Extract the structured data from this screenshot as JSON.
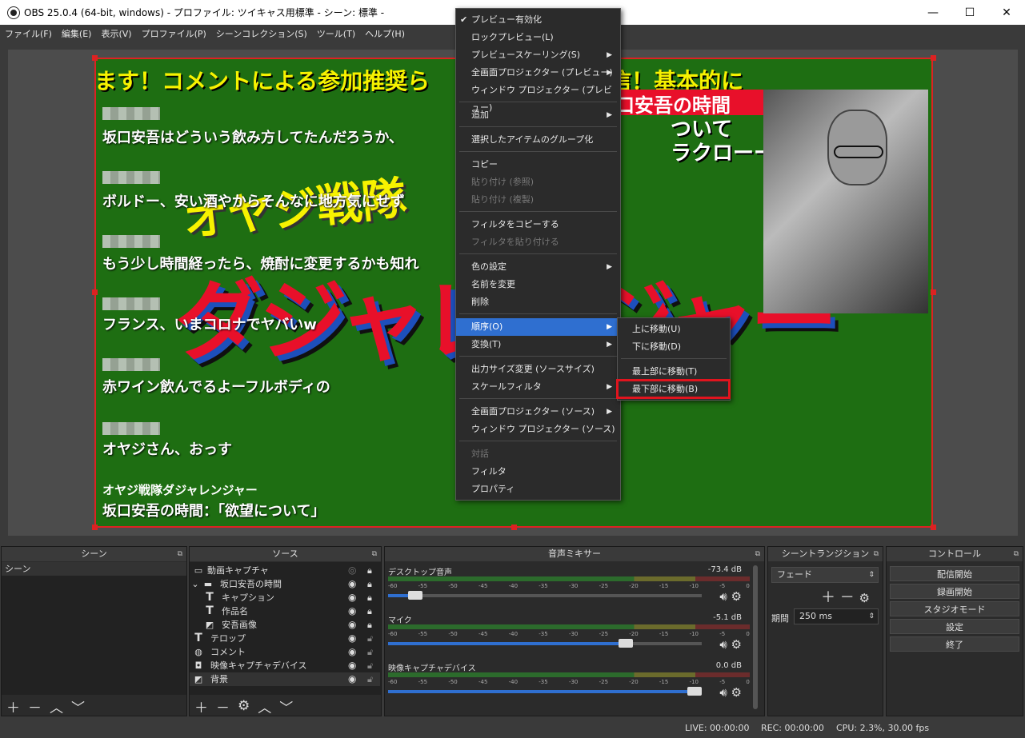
{
  "window": {
    "title": "OBS 25.0.4 (64-bit, windows) - プロファイル: ツイキャス用標準 - シーン: 標準 -",
    "minimize": "—",
    "maximize": "☐",
    "close": "✕"
  },
  "menu": [
    "ファイル(F)",
    "編集(E)",
    "表示(V)",
    "プロファイル(P)",
    "シーンコレクション(S)",
    "ツール(T)",
    "ヘルプ(H)"
  ],
  "preview": {
    "ticker": "ます！コメントによる参加推奨ら　　期気まぐれ配信！基本的に",
    "comments": [
      "坂口安吾はどういう飲み方してたんだろうか、",
      "ボルドー、安い酒やからそんなに地方気にせず",
      "もう少し時間経ったら、焼酎に変更するかも知れ",
      "フランス、いまコロナでヤバいw",
      "赤ワイン飲んでるよーフルボディの",
      "オヤジさん、おっす"
    ],
    "program_name": "オヤジ戦隊ダジャレンジャー",
    "program_topic": "坂口安吾の時間：「欲望について」",
    "subtitle": "オヤジ戦隊",
    "big_title": "ダジャレンジャー",
    "red_box": "口安吾の時間",
    "white_big_1": "ついて",
    "white_big_2": "ラクローー」"
  },
  "context_menu": {
    "items": [
      {
        "label": "プレビュー有効化",
        "checked": true
      },
      {
        "label": "ロックプレビュー(L)"
      },
      {
        "label": "プレビュースケーリング(S)",
        "submenu": true
      },
      {
        "label": "全画面プロジェクター (プレビュー)",
        "submenu": true
      },
      {
        "label": "ウィンドウ プロジェクター (プレビュー)"
      },
      {
        "label": "追加",
        "submenu": true
      },
      {
        "label": "選択したアイテムのグループ化"
      },
      {
        "label": "コピー"
      },
      {
        "label": "貼り付け (参照)",
        "disabled": true
      },
      {
        "label": "貼り付け (複製)",
        "disabled": true
      },
      {
        "label": "フィルタをコピーする"
      },
      {
        "label": "フィルタを貼り付ける",
        "disabled": true
      },
      {
        "label": "色の設定",
        "submenu": true
      },
      {
        "label": "名前を変更"
      },
      {
        "label": "削除"
      },
      {
        "label": "順序(O)",
        "submenu": true,
        "highlighted": true
      },
      {
        "label": "変換(T)",
        "submenu": true
      },
      {
        "label": "出力サイズ変更 (ソースサイズ)"
      },
      {
        "label": "スケールフィルタ",
        "submenu": true
      },
      {
        "label": "全画面プロジェクター (ソース)",
        "submenu": true
      },
      {
        "label": "ウィンドウ プロジェクター (ソース)"
      },
      {
        "label": "対話",
        "disabled": true
      },
      {
        "label": "フィルタ"
      },
      {
        "label": "プロパティ"
      }
    ]
  },
  "order_submenu": [
    "上に移動(U)",
    "下に移動(D)",
    "最上部に移動(T)",
    "最下部に移動(B)"
  ],
  "docks": {
    "scenes": {
      "title": "シーン",
      "items": [
        "シーン"
      ]
    },
    "sources": {
      "title": "ソース",
      "items": [
        {
          "label": "動画キャプチャ",
          "icon": "monitor-icon"
        },
        {
          "label": "坂口安吾の時間",
          "icon": "folder-icon"
        },
        {
          "label": "キャプション",
          "icon": "text-icon"
        },
        {
          "label": "作品名",
          "icon": "text-icon"
        },
        {
          "label": "安吾画像",
          "icon": "image-icon"
        },
        {
          "label": "テロップ",
          "icon": "text-icon"
        },
        {
          "label": "コメント",
          "icon": "globe-icon"
        },
        {
          "label": "映像キャプチャデバイス",
          "icon": "camera-icon"
        },
        {
          "label": "背景",
          "icon": "image-icon"
        }
      ]
    },
    "mixer": {
      "title": "音声ミキサー",
      "channels": [
        {
          "name": "デスクトップ音声",
          "db": "-73.4 dB",
          "level": 0.11
        },
        {
          "name": "マイク",
          "db": "-5.1 dB",
          "level": 0.78
        },
        {
          "name": "映像キャプチャデバイス",
          "db": "0.0 dB",
          "level": 1.0
        }
      ],
      "scale": [
        "-60",
        "-55",
        "-50",
        "-45",
        "-40",
        "-35",
        "-30",
        "-25",
        "-20",
        "-15",
        "-10",
        "-5",
        "0"
      ]
    },
    "transitions": {
      "title": "シーントランジション",
      "selected": "フェード",
      "duration_label": "期間",
      "duration": "250 ms"
    },
    "controls": {
      "title": "コントロール",
      "buttons": [
        "配信開始",
        "録画開始",
        "スタジオモード",
        "設定",
        "終了"
      ]
    }
  },
  "status": {
    "live": "LIVE: 00:00:00",
    "rec": "REC: 00:00:00",
    "cpu": "CPU: 2.3%, 30.00 fps"
  }
}
